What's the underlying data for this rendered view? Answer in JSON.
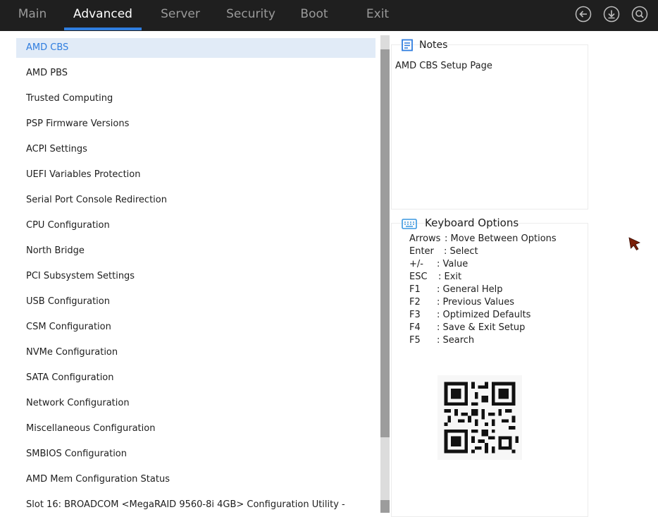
{
  "tabs": [
    {
      "label": "Main"
    },
    {
      "label": "Advanced"
    },
    {
      "label": "Server"
    },
    {
      "label": "Security"
    },
    {
      "label": "Boot"
    },
    {
      "label": "Exit"
    }
  ],
  "active_tab": "Advanced",
  "top_icons": [
    "back-icon",
    "download-icon",
    "search-icon"
  ],
  "menu": {
    "items": [
      {
        "label": "AMD CBS"
      },
      {
        "label": "AMD PBS"
      },
      {
        "label": "Trusted Computing"
      },
      {
        "label": "PSP Firmware Versions"
      },
      {
        "label": "ACPI Settings"
      },
      {
        "label": "UEFI Variables Protection"
      },
      {
        "label": "Serial Port Console Redirection"
      },
      {
        "label": "CPU Configuration"
      },
      {
        "label": "North Bridge"
      },
      {
        "label": "PCI Subsystem Settings"
      },
      {
        "label": "USB Configuration"
      },
      {
        "label": "CSM Configuration"
      },
      {
        "label": "NVMe Configuration"
      },
      {
        "label": "SATA Configuration"
      },
      {
        "label": "Network Configuration"
      },
      {
        "label": "Miscellaneous Configuration"
      },
      {
        "label": "SMBIOS Configuration"
      },
      {
        "label": "AMD Mem Configuration Status"
      },
      {
        "label": "Slot 16: BROADCOM <MegaRAID 9560-8i 4GB> Configuration Utility -"
      }
    ],
    "selected": "AMD CBS"
  },
  "notes": {
    "title": "Notes",
    "text": "AMD CBS Setup Page"
  },
  "keyboard": {
    "title": "Keyboard Options",
    "options": [
      {
        "key": "Arrows",
        "desc": ": Move Between Options"
      },
      {
        "key": "Enter",
        "desc": ": Select"
      },
      {
        "key": "+/-",
        "desc": ": Value"
      },
      {
        "key": "ESC",
        "desc": ": Exit"
      },
      {
        "key": "F1",
        "desc": ": General Help"
      },
      {
        "key": "F2",
        "desc": ": Previous Values"
      },
      {
        "key": "F3",
        "desc": ": Optimized Defaults"
      },
      {
        "key": "F4",
        "desc": ": Save & Exit Setup"
      },
      {
        "key": "F5",
        "desc": ": Search"
      }
    ]
  },
  "colors": {
    "accent": "#2f7ddf",
    "topbar": "#1f1f1f",
    "selected_bg": "#e1ebf7"
  }
}
